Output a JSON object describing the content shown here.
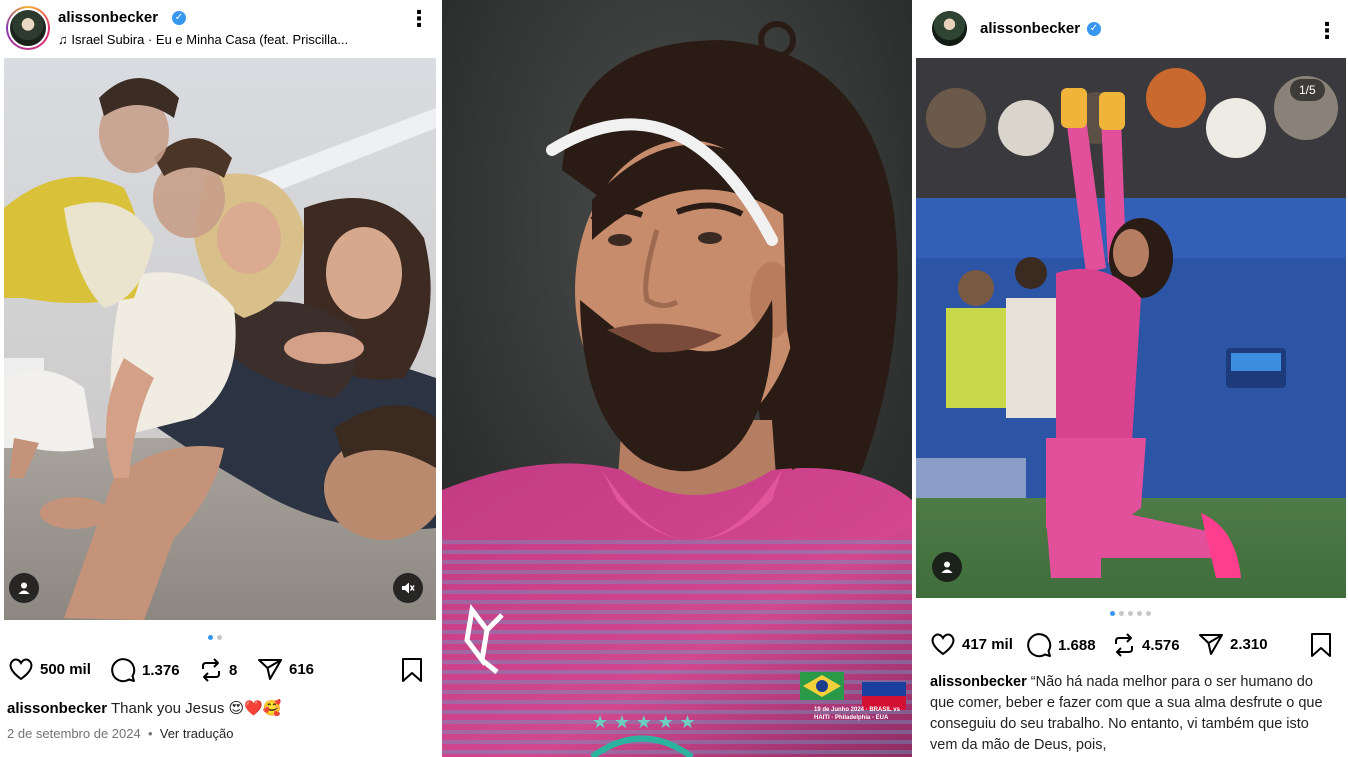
{
  "left_post": {
    "username": "alissonbecker",
    "song": "Israel Subira · Eu e Minha Casa (feat. Priscilla...",
    "likes": "500 mil",
    "comments": "1.376",
    "reposts": "8",
    "shares": "616",
    "caption_user": "alissonbecker",
    "caption_text": "Thank you Jesus 😍❤️🥰",
    "date": "2 de setembro de 2024",
    "translate": "Ver tradução"
  },
  "middle_photo": {
    "kit_text": "19 de Junho 2024 · BRASIL vs HAITI · Philadelphia - EUA"
  },
  "right_post": {
    "username": "alissonbecker",
    "counter": "1/5",
    "likes": "417 mil",
    "comments": "1.688",
    "reposts": "4.576",
    "shares": "2.310",
    "caption_user": "alissonbecker",
    "caption_text": "“Não há nada melhor para o ser humano do que comer, beber e fazer com que a sua alma desfrute o que conseguiu do seu trabalho. No entanto, vi também que isto vem da mão de Deus, pois,"
  },
  "icons": {
    "like": "heart-icon",
    "comment": "comment-icon",
    "repost": "repost-icon",
    "share": "send-icon",
    "save": "bookmark-icon",
    "music": "music-note-icon",
    "tag": "user-tag-icon",
    "mute": "muted-speaker-icon"
  },
  "colors": {
    "verified": "#3897f0",
    "kit_pink": "#d2478f",
    "pitch_green": "#3f6e3c"
  }
}
